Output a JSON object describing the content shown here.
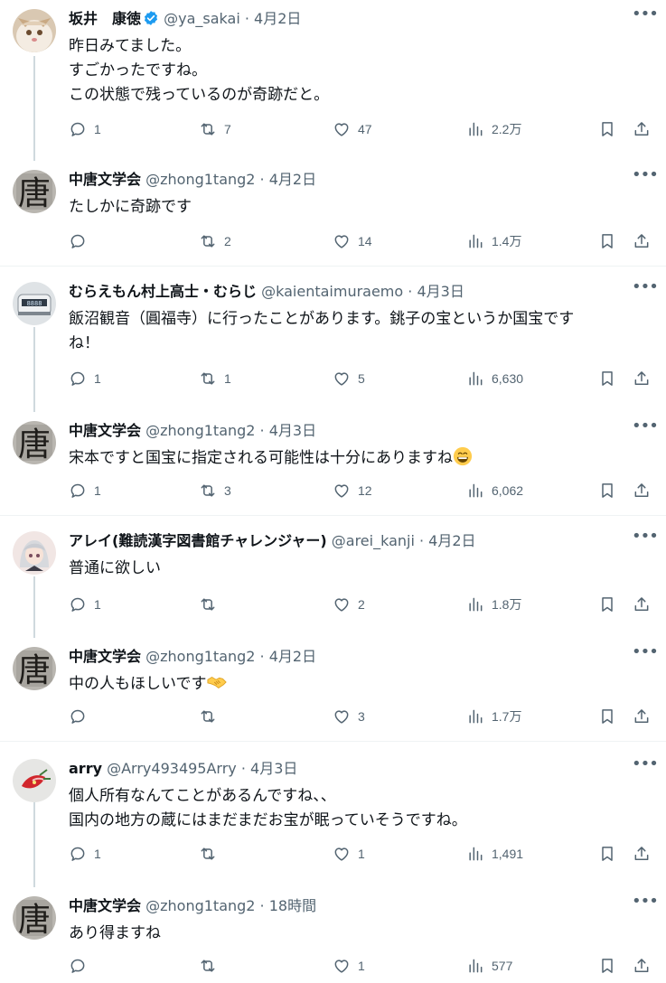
{
  "tweets": [
    {
      "name": "坂井　康徳",
      "verified": true,
      "handle": "@ya_sakai",
      "sep": " · ",
      "time": "4月2日",
      "text": "昨日みてました。\nすごかったですね。\nこの状態で残っているのが奇跡だと。",
      "replies": "1",
      "retweets": "7",
      "likes": "47",
      "views": "2.2万",
      "avatar": "cat-avatar"
    },
    {
      "name": "中唐文学会",
      "handle": "@zhong1tang2",
      "sep": " · ",
      "time": "4月2日",
      "text": "たしかに奇跡です",
      "replies": "",
      "retweets": "2",
      "likes": "14",
      "views": "1.4万",
      "avatar": "calligraphy-avatar"
    },
    {
      "name": "むらえもん村上高士・むらじ",
      "handle": "@kaientaimuraemo",
      "sep": " · ",
      "time": "4月3日",
      "text": "飯沼観音（圓福寺）に行ったことがあります。銚子の宝というか国宝です\nね！",
      "replies": "1",
      "retweets": "1",
      "likes": "5",
      "views": "6,630",
      "avatar": "train-avatar"
    },
    {
      "name": "中唐文学会",
      "handle": "@zhong1tang2",
      "sep": " · ",
      "time": "4月3日",
      "text": "宋本ですと国宝に指定される可能性は十分にありますね",
      "emoji": "grinning",
      "replies": "1",
      "retweets": "3",
      "likes": "12",
      "views": "6,062",
      "avatar": "calligraphy-avatar"
    },
    {
      "name": "アレイ(難読漢字図書館チャレンジャー)",
      "handle": "@arei_kanji",
      "sep": " · ",
      "time": "4月2日",
      "text": "普通に欲しい",
      "replies": "1",
      "retweets": "",
      "likes": "2",
      "views": "1.8万",
      "avatar": "anime-avatar"
    },
    {
      "name": "中唐文学会",
      "handle": "@zhong1tang2",
      "sep": " · ",
      "time": "4月2日",
      "text": "中の人もほしいです",
      "emoji": "handshake",
      "replies": "",
      "retweets": "",
      "likes": "3",
      "views": "1.7万",
      "avatar": "calligraphy-avatar"
    },
    {
      "name": "arry",
      "handle": "@Arry493495Arry",
      "sep": " · ",
      "time": "4月3日",
      "text": "個人所有なんてことがあるんですね、、\n国内の地方の蔵にはまだまだお宝が眠っていそうですね。",
      "replies": "1",
      "retweets": "",
      "likes": "1",
      "views": "1,491",
      "avatar": "flower-avatar"
    },
    {
      "name": "中唐文学会",
      "handle": "@zhong1tang2",
      "sep": " · ",
      "time": "18時間",
      "text": "あり得ますね",
      "replies": "",
      "retweets": "",
      "likes": "1",
      "views": "577",
      "avatar": "calligraphy-avatar"
    }
  ],
  "colors": {
    "text": "#0f1419",
    "secondary": "#536471",
    "verified": "#1d9bf0",
    "divider": "#eff3f4",
    "thread_line": "#cfd9de"
  }
}
